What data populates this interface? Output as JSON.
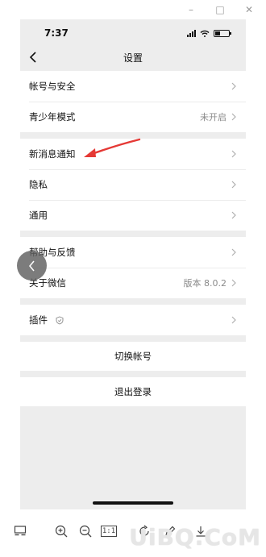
{
  "window_controls": {
    "minimize": "–",
    "maximize": "□",
    "close": "✕"
  },
  "status": {
    "time": "7:37"
  },
  "nav": {
    "title": "设置"
  },
  "groups": [
    {
      "items": [
        {
          "label": "帐号与安全",
          "value": ""
        },
        {
          "label": "青少年模式",
          "value": "未开启"
        }
      ]
    },
    {
      "items": [
        {
          "label": "新消息通知",
          "value": ""
        },
        {
          "label": "隐私",
          "value": ""
        },
        {
          "label": "通用",
          "value": ""
        }
      ]
    },
    {
      "items": [
        {
          "label": "帮助与反馈",
          "value": ""
        },
        {
          "label": "关于微信",
          "value": "版本 8.0.2"
        }
      ]
    },
    {
      "items": [
        {
          "label": "插件",
          "value": ""
        }
      ]
    }
  ],
  "actions": {
    "switch_account": "切换帐号",
    "logout": "退出登录"
  },
  "toolbar": {
    "one_to_one": "1:1"
  },
  "watermark": "UiBQ.CoM",
  "colors": {
    "annotation_arrow": "#e53935",
    "page_bg": "#ededed"
  },
  "icons": [
    "back-icon",
    "chevron-right-icon",
    "shield-icon",
    "signal-icon",
    "wifi-icon",
    "battery-icon",
    "zoom-in-icon",
    "zoom-out-icon",
    "rotate-icon",
    "edit-icon",
    "download-icon",
    "thumbnail-icon"
  ]
}
